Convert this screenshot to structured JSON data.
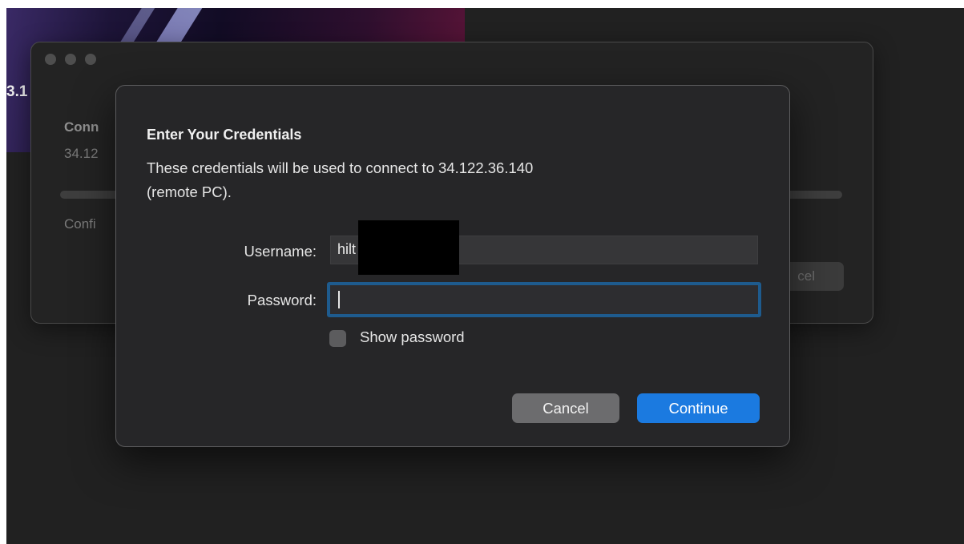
{
  "background": {
    "wallpaper_text": "3.1",
    "window": {
      "heading": "Conn",
      "address": "34.12",
      "status": "Confi",
      "cancel_label": "cel"
    }
  },
  "dialog": {
    "title": "Enter Your Credentials",
    "message_line1": "These credentials will be used to connect to 34.122.36.140",
    "message_line2": "(remote PC).",
    "username_label": "Username:",
    "username_value": "hilt",
    "password_label": "Password:",
    "password_value": "",
    "show_password_label": "Show password",
    "show_password_checked": false,
    "cancel_label": "Cancel",
    "continue_label": "Continue"
  },
  "colors": {
    "accent": "#1b7ae0",
    "focus_ring": "#1e5b8e",
    "dialog_bg": "#262628",
    "screen_bg": "#212121"
  }
}
